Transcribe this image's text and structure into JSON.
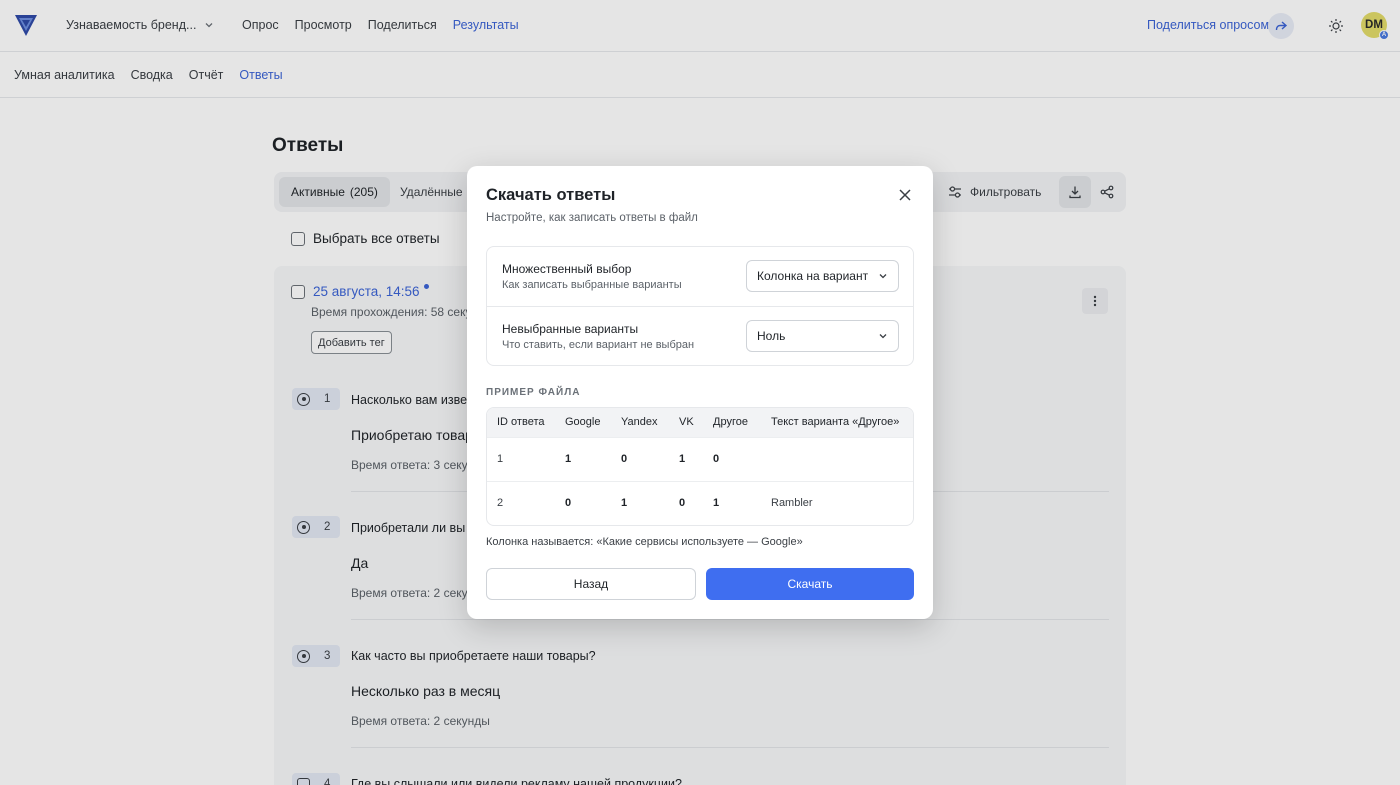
{
  "header": {
    "project_name": "Узнаваемость бренд...",
    "nav": [
      "Опрос",
      "Просмотр",
      "Поделиться",
      "Результаты"
    ],
    "share_survey": "Поделиться опросом",
    "avatar_initials": "DM",
    "avatar_badge": "A"
  },
  "subnav": [
    "Умная аналитика",
    "Сводка",
    "Отчёт",
    "Ответы"
  ],
  "page": {
    "title": "Ответы",
    "tab_active_label": "Активные",
    "tab_active_count": "(205)",
    "tab_deleted": "Удалённые",
    "filter": "Фильтровать",
    "select_all": "Выбрать все ответы"
  },
  "response": {
    "date": "25 августа, 14:56",
    "duration": "Время прохождения: 58 секу",
    "add_tag": "Добавить тег",
    "questions": [
      {
        "num": "1",
        "text": "Насколько вам извест",
        "answer": "Приобретаю товар",
        "time": "Время ответа: 3 секун"
      },
      {
        "num": "2",
        "text": "Приобретали ли вы на",
        "answer": "Да",
        "time": "Время ответа: 2 секун"
      },
      {
        "num": "3",
        "text": "Как часто вы приобретаете наши товары?",
        "answer": "Несколько раз в месяц",
        "time": "Время ответа: 2 секунды"
      },
      {
        "num": "4",
        "text": "Где вы слышали или видели рекламу нашей продукции?"
      }
    ]
  },
  "modal": {
    "title": "Скачать ответы",
    "subtitle": "Настройте, как записать ответы в файл",
    "options": [
      {
        "label": "Множественный выбор",
        "desc": "Как записать выбранные варианты",
        "value": "Колонка на вариант"
      },
      {
        "label": "Невыбранные варианты",
        "desc": "Что ставить, если вариант не выбран",
        "value": "Ноль"
      }
    ],
    "sample_label": "ПРИМЕР ФАЙЛА",
    "sample_headers": [
      "ID ответа",
      "Google",
      "Yandex",
      "VK",
      "Другое",
      "Текст варианта «Другое»"
    ],
    "sample_rows": [
      [
        "1",
        "1",
        "0",
        "1",
        "0",
        ""
      ],
      [
        "2",
        "0",
        "1",
        "0",
        "1",
        "Rambler"
      ]
    ],
    "column_note": "Колонка называется: «Какие сервисы используете — Google»",
    "back": "Назад",
    "download": "Скачать"
  },
  "colors": {
    "accent": "#3c64d6",
    "primary_button": "#3f6ef0",
    "avatar_bg": "#e3dc6a"
  }
}
